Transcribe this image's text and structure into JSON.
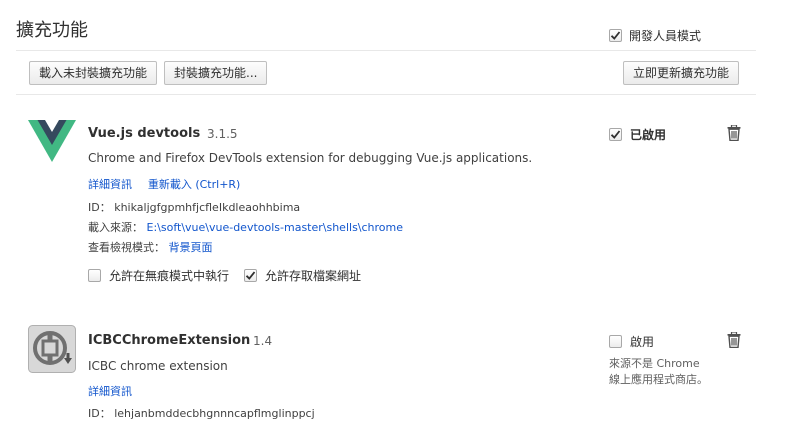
{
  "header": {
    "title": "擴充功能",
    "dev_mode_label": "開發人員模式",
    "dev_mode_checked": true
  },
  "toolbar": {
    "load_unpacked_label": "載入未封裝擴充功能",
    "pack_label": "封裝擴充功能...",
    "update_label": "立即更新擴充功能"
  },
  "extensions": [
    {
      "name": "Vue.js devtools",
      "version": "3.1.5",
      "description": "Chrome and Firefox DevTools extension for debugging Vue.js applications.",
      "details_link": "詳細資訊",
      "reload_link": "重新載入 (Ctrl+R)",
      "id_label": "ID：",
      "id_value": "khikaljgfgpmhfjcfleIkdleaohhbima",
      "source_label": "載入來源：",
      "source_value": "E:\\soft\\vue\\vue-devtools-master\\shells\\chrome",
      "inspect_label": "查看檢視模式：",
      "inspect_link": "背景頁面",
      "incognito_label": "允許在無痕模式中執行",
      "incognito_checked": false,
      "file_urls_label": "允許存取檔案網址",
      "file_urls_checked": true,
      "enabled_label": "已啟用",
      "enabled": true,
      "icon": "vue-logo-icon"
    },
    {
      "name": "ICBCChromeExtension",
      "version": "1.4",
      "description": "ICBC chrome extension",
      "details_link": "詳細資訊",
      "id_label": "ID：",
      "id_value": "lehjanbmddecbhgnnncapflmglinppcj",
      "enabled_label": "啟用",
      "enabled": false,
      "note": "來源不是 Chrome 線上應用程式商店。",
      "icon": "icbc-logo-icon"
    }
  ],
  "colors": {
    "link": "#1155cc",
    "vue_green": "#41b883",
    "vue_dark": "#35495e"
  }
}
